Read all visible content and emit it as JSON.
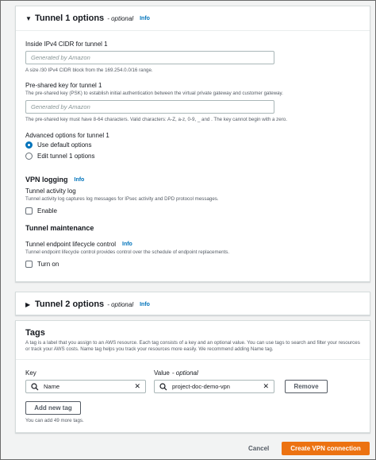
{
  "tunnel1": {
    "title": "Tunnel 1 options",
    "optional": "- optional",
    "info": "Info",
    "inside_cidr": {
      "label": "Inside IPv4 CIDR for tunnel 1",
      "placeholder": "Generated by Amazon",
      "help": "A size /30 IPv4 CIDR block from the 169.254.0.0/16 range."
    },
    "psk": {
      "label": "Pre-shared key for tunnel 1",
      "description": "The pre-shared key (PSK) to establish initial authentication between the virtual private gateway and customer gateway.",
      "placeholder": "Generated by Amazon",
      "help": "The pre-shared key must have 8-64 characters. Valid characters: A-Z, a-z, 0-9, _ and . The key cannot begin with a zero."
    },
    "advanced": {
      "label": "Advanced options for tunnel 1",
      "options": [
        "Use default options",
        "Edit tunnel 1 options"
      ],
      "selected": "Use default options"
    },
    "vpn_logging": {
      "heading": "VPN logging",
      "info": "Info",
      "label": "Tunnel activity log",
      "description": "Tunnel activity log captures log messages for IPsec activity and DPD protocol messages.",
      "checkbox": "Enable"
    },
    "maintenance": {
      "heading": "Tunnel maintenance",
      "label": "Tunnel endpoint lifecycle control",
      "info": "Info",
      "description": "Tunnel endpoint lifecycle control provides control over the schedule of endpoint replacements.",
      "checkbox": "Turn on"
    }
  },
  "tunnel2": {
    "title": "Tunnel 2 options",
    "optional": "- optional",
    "info": "Info"
  },
  "tags": {
    "title": "Tags",
    "description": "A tag is a label that you assign to an AWS resource. Each tag consists of a key and an optional value. You can use tags to search and filter your resources or track your AWS costs. Name tag helps you track your resources more easily. We recommend adding Name tag.",
    "key_label": "Key",
    "value_label": "Value",
    "value_optional": "- optional",
    "key_value": "Name",
    "value_value": "project-doc-demo-vpn",
    "remove_label": "Remove",
    "add_label": "Add new tag",
    "remaining": "You can add 49 more tags."
  },
  "footer": {
    "cancel": "Cancel",
    "create": "Create VPN connection"
  },
  "colors": {
    "primary": "#ec7211",
    "link": "#0073bb"
  }
}
